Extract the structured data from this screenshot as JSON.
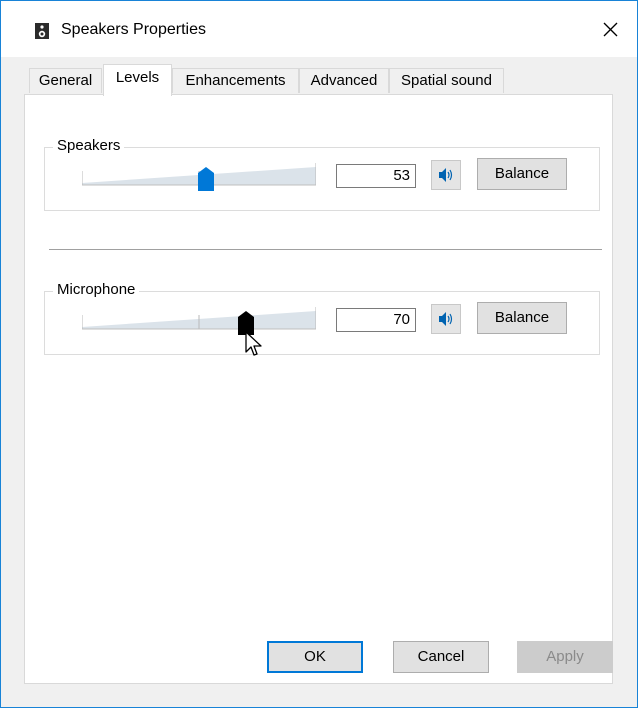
{
  "window": {
    "title": "Speakers Properties"
  },
  "tabs": [
    "General",
    "Levels",
    "Enhancements",
    "Advanced",
    "Spatial sound"
  ],
  "active_tab": "Levels",
  "levels": {
    "speakers": {
      "label": "Speakers",
      "value": "53",
      "level": 53,
      "balance_label": "Balance"
    },
    "microphone": {
      "label": "Microphone",
      "value": "70",
      "level": 70,
      "balance_label": "Balance"
    }
  },
  "footer": {
    "ok": "OK",
    "cancel": "Cancel",
    "apply": "Apply"
  },
  "colors": {
    "accent": "#0078d7",
    "thumb_active": "#0078d7",
    "thumb_dragging": "#000000"
  },
  "icons": {
    "app": "speaker-icon",
    "close": "close-icon",
    "mute": "speaker-volume-icon",
    "cursor": "mouse-pointer-icon"
  }
}
